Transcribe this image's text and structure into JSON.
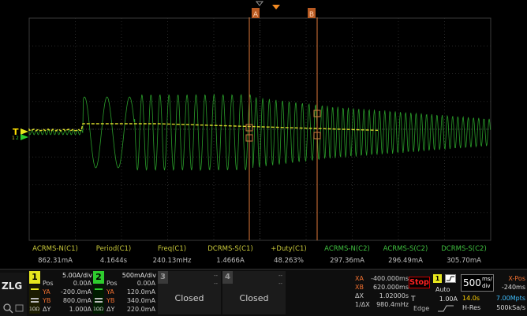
{
  "markers": {
    "cursor_a": "A",
    "cursor_b": "B",
    "trigger_level": "T"
  },
  "channel_markers": {
    "ch1": "1",
    "ch2": "2"
  },
  "measurements": [
    {
      "label": "ACRMS-N(C1)",
      "value": "862.31mA",
      "color": "#c8c83a"
    },
    {
      "label": "Period(C1)",
      "value": "4.1644s",
      "color": "#c8c83a"
    },
    {
      "label": "Freq(C1)",
      "value": "240.13mHz",
      "color": "#c8c83a"
    },
    {
      "label": "DCRMS-S(C1)",
      "value": "1.4666A",
      "color": "#c8c83a"
    },
    {
      "label": "+Duty(C1)",
      "value": "48.263%",
      "color": "#c8c83a"
    },
    {
      "label": "ACRMS-N(C2)",
      "value": "297.36mA",
      "color": "#3fbf3f"
    },
    {
      "label": "ACRMS-S(C2)",
      "value": "296.49mA",
      "color": "#3fbf3f"
    },
    {
      "label": "DCRMS-S(C2)",
      "value": "305.70mA",
      "color": "#3fbf3f"
    }
  ],
  "logo": "ZLG",
  "channels": [
    {
      "num": "1",
      "color": "#e6e61e",
      "scale": "5.00A/div",
      "pos_label": "Pos",
      "pos_value": "0.00A",
      "ya_label": "YA",
      "ya_value": "-200.0mA",
      "yb_label": "YB",
      "yb_value": "800.0mA",
      "dy_label": "ΔY",
      "dy_value": "1.000A",
      "coupling": "1ΩΩ"
    },
    {
      "num": "2",
      "color": "#2ecc2e",
      "scale": "500mA/div",
      "pos_label": "Pos",
      "pos_value": "0.00A",
      "ya_label": "YA",
      "ya_value": "120.0mA",
      "yb_label": "YB",
      "yb_value": "340.0mA",
      "dy_label": "ΔY",
      "dy_value": "220.0mA",
      "coupling": "1ΩΩ"
    }
  ],
  "closed_channels": [
    {
      "num": "3",
      "dash1": "--",
      "dash2": "--",
      "label": "Closed"
    },
    {
      "num": "4",
      "dash1": "--",
      "dash2": "--",
      "label": "Closed"
    }
  ],
  "cursors": {
    "xa_label": "XA",
    "xa_value": "-400.000ms",
    "xb_label": "XB",
    "xb_value": "620.000ms",
    "dx_label": "ΔX",
    "dx_value": "1.02000s",
    "inv_label": "1/ΔX",
    "inv_value": "980.4mHz"
  },
  "run_state": "Stop",
  "trigger": {
    "source": "1",
    "mode": "Auto",
    "type_label": "T",
    "level": "1.00A",
    "edge_label": "Edge"
  },
  "timebase": {
    "scale_main": "500",
    "scale_unit_top": "ms/",
    "scale_unit_bottom": "div",
    "xpos_label": "X-Pos",
    "xpos_value": "-240ms",
    "record_len": "14.0s",
    "sample_rate": "7.00Mpts",
    "acq_mode": "H-Res",
    "acq_rate": "500kSa/s"
  }
}
